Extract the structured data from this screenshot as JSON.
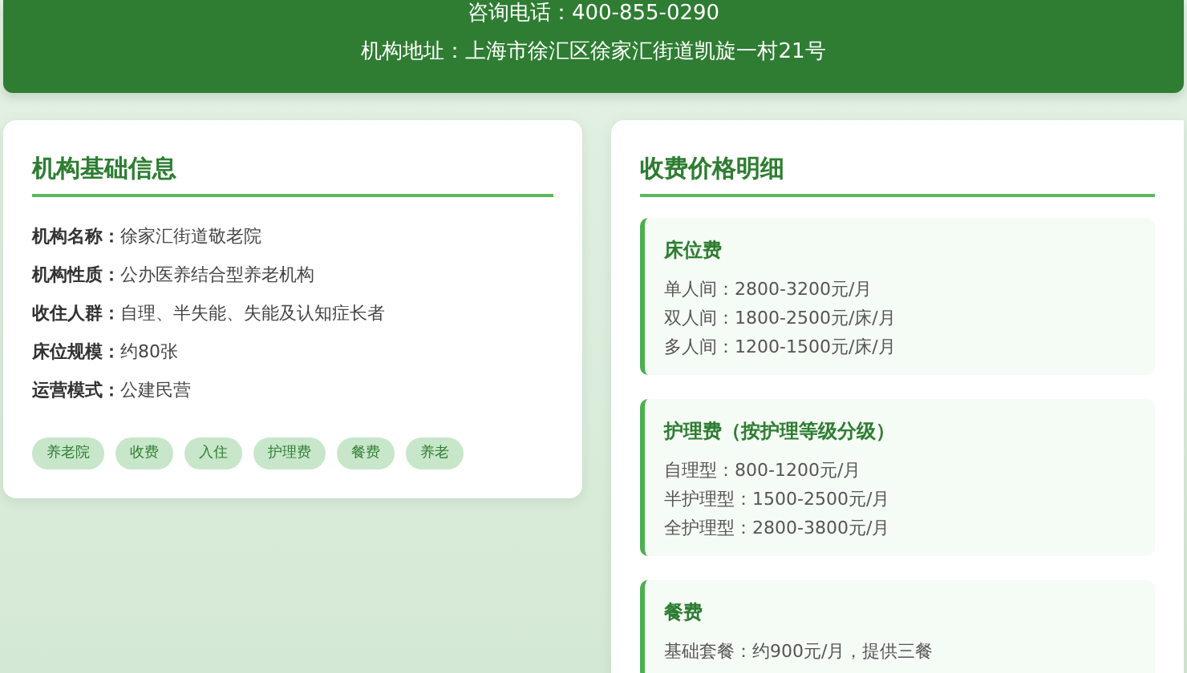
{
  "header": {
    "phone_line": "咨询电话：400-855-0290",
    "address_line": "机构地址：上海市徐汇区徐家汇街道凯旋一村21号"
  },
  "basic_info": {
    "title": "机构基础信息",
    "rows": [
      {
        "label": "机构名称：",
        "value": "徐家汇街道敬老院"
      },
      {
        "label": "机构性质：",
        "value": "公办医养结合型养老机构"
      },
      {
        "label": "收住人群：",
        "value": "自理、半失能、失能及认知症长者"
      },
      {
        "label": "床位规模：",
        "value": "约80张"
      },
      {
        "label": "运营模式：",
        "value": "公建民营"
      }
    ],
    "tags": [
      "养老院",
      "收费",
      "入住",
      "护理费",
      "餐费",
      "养老"
    ]
  },
  "fees": {
    "title": "收费价格明细",
    "sections": [
      {
        "title": "床位费",
        "lines": [
          "单人间：2800-3200元/月",
          "双人间：1800-2500元/床/月",
          "多人间：1200-1500元/床/月"
        ]
      },
      {
        "title": "护理费（按护理等级分级）",
        "lines": [
          "自理型：800-1200元/月",
          "半护理型：1500-2500元/月",
          "全护理型：2800-3800元/月"
        ]
      },
      {
        "title": "餐费",
        "lines": [
          "基础套餐：约900元/月，提供三餐"
        ]
      }
    ]
  }
}
